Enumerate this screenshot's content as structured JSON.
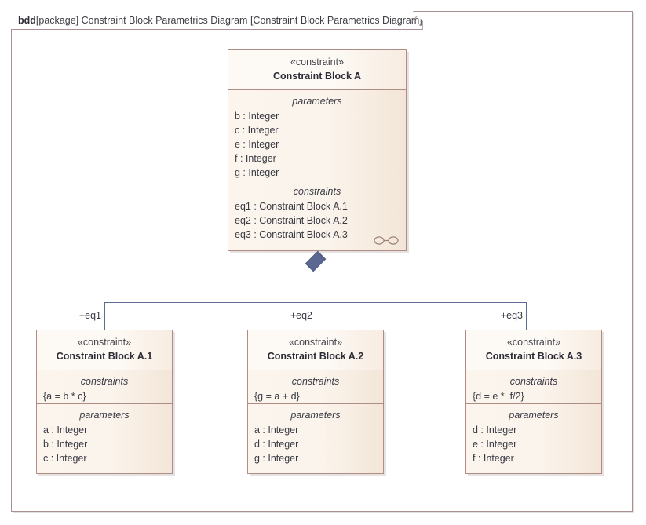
{
  "frame": {
    "keyword": "bdd",
    "qualifier": "[package] Constraint Block Parametrics Diagram [Constraint Block Parametrics Diagram]"
  },
  "colors": {
    "frame_border": "#a98f90",
    "block_border": "#b08d84",
    "block_fill": "#fbf5ee",
    "connector": "#5e6c93",
    "diamond_fill": "#5a6790",
    "text": "#3a3a44"
  },
  "parent_block": {
    "stereotype": "«constraint»",
    "name": "Constraint Block A",
    "compartments": [
      {
        "label": "parameters",
        "features": [
          "b : Integer",
          "c : Integer",
          "e : Integer",
          "f : Integer",
          "g : Integer"
        ]
      },
      {
        "label": "constraints",
        "features": [
          "eq1 : Constraint Block A.1",
          "eq2 : Constraint Block A.2",
          "eq3 : Constraint Block A.3"
        ],
        "icon": "parametric-diagram-icon"
      }
    ]
  },
  "edges": [
    {
      "label": "+eq1"
    },
    {
      "label": "+eq2"
    },
    {
      "label": "+eq3"
    }
  ],
  "child_blocks": [
    {
      "stereotype": "«constraint»",
      "name": "Constraint Block A.1",
      "compartments": [
        {
          "label": "constraints",
          "features": [
            "{a = b * c}"
          ]
        },
        {
          "label": "parameters",
          "features": [
            "a : Integer",
            "b : Integer",
            "c : Integer"
          ]
        }
      ]
    },
    {
      "stereotype": "«constraint»",
      "name": "Constraint Block A.2",
      "compartments": [
        {
          "label": "constraints",
          "features": [
            "{g = a + d}"
          ]
        },
        {
          "label": "parameters",
          "features": [
            "a : Integer",
            "d : Integer",
            "g : Integer"
          ]
        }
      ]
    },
    {
      "stereotype": "«constraint»",
      "name": "Constraint Block A.3",
      "compartments": [
        {
          "label": "constraints",
          "features": [
            "{d = e *  f/2}"
          ]
        },
        {
          "label": "parameters",
          "features": [
            "d : Integer",
            "e : Integer",
            "f : Integer"
          ]
        }
      ]
    }
  ]
}
